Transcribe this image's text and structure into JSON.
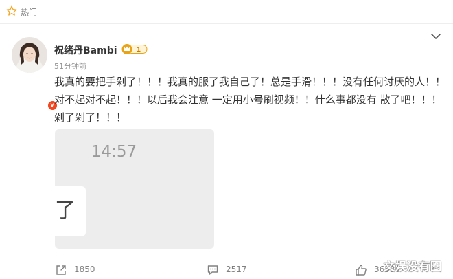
{
  "header": {
    "section_label": "热门",
    "section_icon": "star-outline-icon"
  },
  "post": {
    "author": "祝绪丹Bambi",
    "verified_mark": "v",
    "vip_level": "1",
    "time": "51分钟前",
    "text": "我真的要把手剁了！！！我真的服了我自己了！总是手滑！！！没有任何讨厌的人！！对不起对不起！！！以后我会注意 一定用小号刷视频！！什么事都没有 散了吧！！！剁了剁了！！！",
    "media": {
      "clock": "14:57",
      "bubble_text": "了"
    }
  },
  "actions": {
    "repost_count": "1850",
    "comment_count": "2517",
    "like_count": "36530"
  },
  "watermark": "文娱没有圈",
  "colors": {
    "accent_orange": "#f5461f",
    "vip_gold": "#e8a317",
    "muted_text": "#808080"
  }
}
